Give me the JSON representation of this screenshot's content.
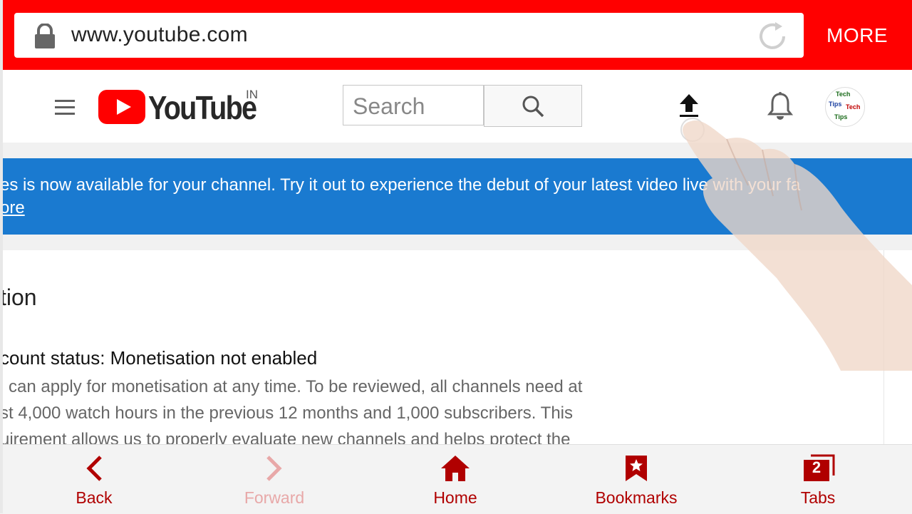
{
  "browser": {
    "url": "www.youtube.com",
    "more_label": "MORE",
    "accent_color": "#ff0000"
  },
  "header": {
    "logo_text": "YouTube",
    "region": "IN",
    "search_placeholder": "Search"
  },
  "banner": {
    "text": "es is now available for your channel. Try it out to experience the debut of your latest video live with your fa",
    "link": "ore",
    "color": "#1a7ad0"
  },
  "content": {
    "section_title": "tion",
    "status": "count status: Monetisation not enabled",
    "body_lines": [
      "can apply for monetisation at any time. To be reviewed, all channels need at",
      "st 4,000 watch hours in the previous 12 months and 1,000 subscribers. This",
      "uirement allows us to properly evaluate new channels and helps protect the"
    ]
  },
  "bottom_nav": {
    "items": [
      {
        "label": "Back",
        "icon": "chevron-left-icon"
      },
      {
        "label": "Forward",
        "icon": "chevron-right-icon"
      },
      {
        "label": "Home",
        "icon": "home-icon"
      },
      {
        "label": "Bookmarks",
        "icon": "bookmark-star-icon"
      },
      {
        "label": "Tabs",
        "icon": "tabs-icon",
        "count": "2"
      }
    ],
    "color": "#b00000"
  },
  "avatar_text": [
    "Tech",
    "Tips",
    "Tech",
    "Tips"
  ]
}
